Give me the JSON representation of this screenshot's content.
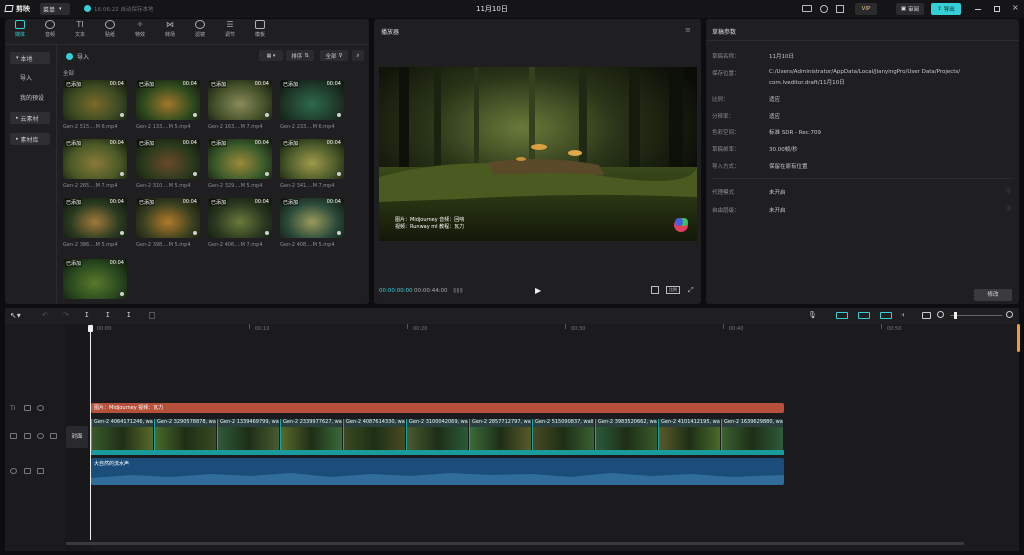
{
  "app": {
    "name": "剪映",
    "menu_label": "菜单",
    "autosave": "16:06:22 自动保存本地",
    "title": "11月10日",
    "vip": "VIP",
    "share": "审阅",
    "export": "导出"
  },
  "toolbar": [
    {
      "label": "媒体"
    },
    {
      "label": "音频"
    },
    {
      "label": "文本"
    },
    {
      "label": "贴纸"
    },
    {
      "label": "特效"
    },
    {
      "label": "转场"
    },
    {
      "label": "滤镜"
    },
    {
      "label": "调节"
    },
    {
      "label": "模板"
    }
  ],
  "sidebar": {
    "items": [
      {
        "label": "本地"
      },
      {
        "label": "导入"
      },
      {
        "label": "我的预设"
      },
      {
        "label": "云素材"
      },
      {
        "label": "素材库"
      }
    ]
  },
  "media": {
    "import_label": "导入",
    "sort_label": "排序",
    "filter_label": "全部",
    "section_label": "全部",
    "items": [
      {
        "status": "已添加",
        "duration": "00:04",
        "caption": "Gen-2 515....M 6.mp4",
        "c1": "#3b4a22",
        "c2": "#7a6a2a"
      },
      {
        "status": "已添加",
        "duration": "00:04",
        "caption": "Gen-2 133....M 5.mp4",
        "c1": "#2f4a1e",
        "c2": "#a0782a"
      },
      {
        "status": "已添加",
        "duration": "00:04",
        "caption": "Gen-2 163....M 7.mp4",
        "c1": "#44522a",
        "c2": "#8a8a5a"
      },
      {
        "status": "已添加",
        "duration": "00:04",
        "caption": "Gen-2 233....M 6.mp4",
        "c1": "#1f3a2a",
        "c2": "#2d6a4a"
      },
      {
        "status": "已添加",
        "duration": "00:04",
        "caption": "Gen-2 265....M 7.mp4",
        "c1": "#4a5a26",
        "c2": "#8a7a3a"
      },
      {
        "status": "已添加",
        "duration": "00:04",
        "caption": "Gen-2 310....M 5.mp4",
        "c1": "#2a3a1c",
        "c2": "#6a4a2a"
      },
      {
        "status": "已添加",
        "duration": "00:04",
        "caption": "Gen-2 329....M 5.mp4",
        "c1": "#3a5a2a",
        "c2": "#9a8a3a"
      },
      {
        "status": "已添加",
        "duration": "00:04",
        "caption": "Gen-2 341....M 7.mp4",
        "c1": "#4a5a2a",
        "c2": "#a09a4a"
      },
      {
        "status": "已添加",
        "duration": "00:04",
        "caption": "Gen-2 386....M 5.mp4",
        "c1": "#2a3a20",
        "c2": "#a07a3a"
      },
      {
        "status": "已添加",
        "duration": "00:04",
        "caption": "Gen-2 398....M 5.mp4",
        "c1": "#3a4020",
        "c2": "#b07a2a"
      },
      {
        "status": "已添加",
        "duration": "00:04",
        "caption": "Gen-2 406....M 7.mp4",
        "c1": "#2a3820",
        "c2": "#6a7a3a"
      },
      {
        "status": "已添加",
        "duration": "00:04",
        "caption": "Gen-2 408....M 5.mp4",
        "c1": "#2a4a3a",
        "c2": "#9a9a5a"
      },
      {
        "status": "已添加",
        "duration": "00:04",
        "caption": "",
        "c1": "#2a4a20",
        "c2": "#5a7a2a"
      }
    ]
  },
  "player": {
    "title": "播放器",
    "time_current": "00:00:00:00",
    "time_total": "00:00:44:00",
    "subtitle_line1": "图片：Midjourney    音频：回响",
    "subtitle_line2": "视频：Runway ml    教程：瓦力",
    "ratio_label": "比例"
  },
  "draft": {
    "title": "草稿参数",
    "rows": [
      {
        "label": "草稿名称：",
        "value": "11月10日"
      },
      {
        "label": "保存位置：",
        "value": "C:/Users/Administrator/AppData/Local/JianyingPro/User Data/Projects/"
      },
      {
        "label": "",
        "value": "com.lveditor.draft/11月10日"
      },
      {
        "label": "比例：",
        "value": "适应"
      },
      {
        "label": "分辨率：",
        "value": "适应"
      },
      {
        "label": "色彩空间：",
        "value": "标准 SDR - Rec.709"
      },
      {
        "label": "草稿帧率：",
        "value": "30.00帧/秒"
      },
      {
        "label": "导入方式：",
        "value": "保留在原有位置"
      },
      {
        "label": "代理模式",
        "value": "未开启"
      },
      {
        "label": "自由层级：",
        "value": "未开启"
      }
    ],
    "edit_button": "修改"
  },
  "timeline": {
    "ruler": [
      "00:00",
      "00:10",
      "00:20",
      "00:30",
      "00:40",
      "00:50"
    ],
    "cover_label": "封面",
    "text_clip": "图片：Midjourney    视频：瓦力",
    "video_clips": [
      "Gen-2 4064171246, wa",
      "Gen-2 3290578878, wa",
      "Gen-2 1339469799, wa",
      "Gen-2 2339977627, wa",
      "Gen-2 4087614330, wa",
      "Gen-2 3100042069, wa",
      "Gen-2 2857712797, wa",
      "Gen-2 515090837, wall",
      "Gen-2 3983520662, wa",
      "Gen-2 4101412195, wa",
      "Gen-2 1639629880, wa"
    ],
    "audio_clip": "大自然的流水声"
  },
  "colors": {
    "accent": "#35d0d6",
    "text_clip": "#b5513a",
    "video_track": "#1a9b9b",
    "audio_track": "#1a4d7a"
  }
}
